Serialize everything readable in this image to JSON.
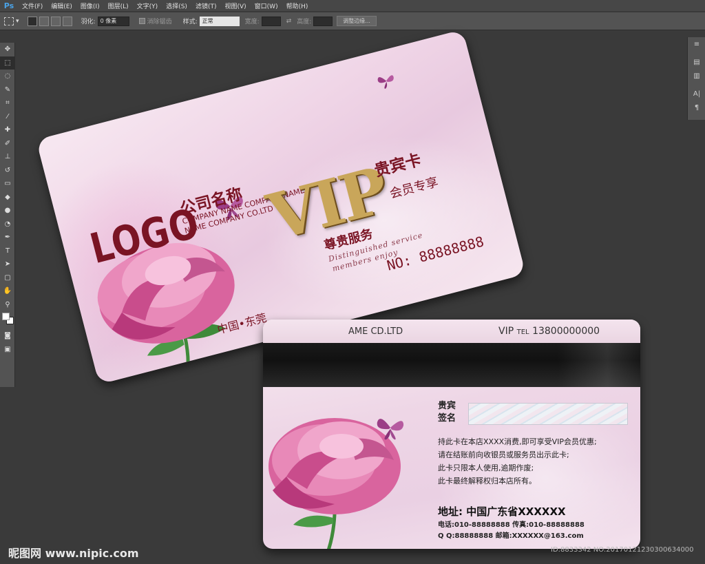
{
  "app": {
    "logo": "Ps"
  },
  "menu": [
    "文件(F)",
    "编辑(E)",
    "图像(I)",
    "图层(L)",
    "文字(Y)",
    "选择(S)",
    "滤镜(T)",
    "视图(V)",
    "窗口(W)",
    "帮助(H)"
  ],
  "options": {
    "feather_label": "羽化:",
    "feather_value": "0 像素",
    "antialias_label": "消除锯齿",
    "style_label": "样式:",
    "style_value": "正常",
    "width_label": "宽度:",
    "height_label": "高度:",
    "refine_button": "调整边缘..."
  },
  "front_card": {
    "logo": "LOGO",
    "company_cn": "公司名称",
    "company_en_line1": "COMPANY NAME COMPANY NAME",
    "company_en_line2": "NAME COMPANY CO.LTD",
    "vip": "VIP",
    "vip_cn": "贵宾卡",
    "slogan1": "尊贵服务",
    "slogan2": "会员专享",
    "script_line1": "Distinguished service",
    "script_line2": "members enjoy",
    "card_no": "NO: 88888888",
    "location": "中国•东莞"
  },
  "back_card": {
    "company": "AME CD.LTD",
    "vip": "VIP",
    "tel_label": "TEL",
    "tel_value": "13800000000",
    "guest_label_1": "贵宾",
    "guest_label_2": "签名",
    "terms": [
      "持此卡在本店XXXX消费,即可享受VIP会员优惠;",
      "请在结账前向收银员或服务员出示此卡;",
      "此卡只限本人使用,逾期作废;",
      "此卡最终解释权归本店所有。"
    ],
    "address": "地址: 中国广东省XXXXXX",
    "phone": "电话:010-88888888  传真:010-88888888",
    "qq_email": "Q Q:88888888  邮箱:XXXXXX@163.com"
  },
  "watermark": {
    "left": "昵图网 www.nipic.com",
    "right": "ID:8833342 NO:20170121230300634000"
  },
  "colors": {
    "brand": "#7a1424",
    "gold": "#c9a65a",
    "background": "#3a3a3a"
  }
}
